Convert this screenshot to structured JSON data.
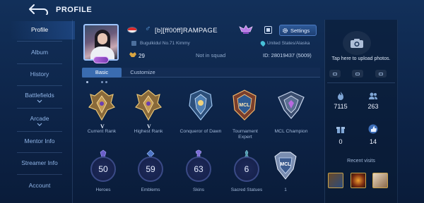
{
  "header": {
    "title": "PROFILE"
  },
  "sidebar": {
    "items": [
      {
        "label": "Profile",
        "active": true
      },
      {
        "label": "Album"
      },
      {
        "label": "History"
      },
      {
        "label": "Battlefields",
        "expandable": true
      },
      {
        "label": "Arcade",
        "expandable": true
      },
      {
        "label": "Mentor Info"
      },
      {
        "label": "Streamer Info"
      },
      {
        "label": "Account"
      }
    ]
  },
  "profile": {
    "player_name": "[b][ff00ff]RAMPAGE",
    "gender_symbol": "♂",
    "guild": "Bugulkidul No.71 Kimmy",
    "level": "29",
    "squad_status": "Not in squad",
    "location": "United States/Alaska",
    "id_text": "ID:  28019437 (5009)",
    "settings_label": "Settings"
  },
  "tabs": [
    {
      "label": "Basic",
      "active": true
    },
    {
      "label": "Customize"
    }
  ],
  "ranks": [
    {
      "label": "Current Rank",
      "numeral": "V"
    },
    {
      "label": "Highest Rank",
      "numeral": "V"
    },
    {
      "label": "Conqueror of Dawn"
    },
    {
      "label": "Tournament Expert",
      "emblem_text": "MCL"
    },
    {
      "label": "MCL Champion"
    }
  ],
  "stats": [
    {
      "label": "Heroes",
      "value": "50"
    },
    {
      "label": "Emblems",
      "value": "59"
    },
    {
      "label": "Skins",
      "value": "63"
    },
    {
      "label": "Sacred Statues",
      "value": "6"
    }
  ],
  "extra_badge": {
    "label": "1",
    "emblem_text": "MCL"
  },
  "right_panel": {
    "upload_text": "Tap here to upload photos.",
    "likes": "7115",
    "followers": "263",
    "gifts": "0",
    "thumbs": "14",
    "recent_visits_label": "Recent visits"
  },
  "colors": {
    "accent": "#3a6cb0",
    "gold": "#c9a24a",
    "purple": "#b06ad9",
    "background": "#0d2448"
  }
}
